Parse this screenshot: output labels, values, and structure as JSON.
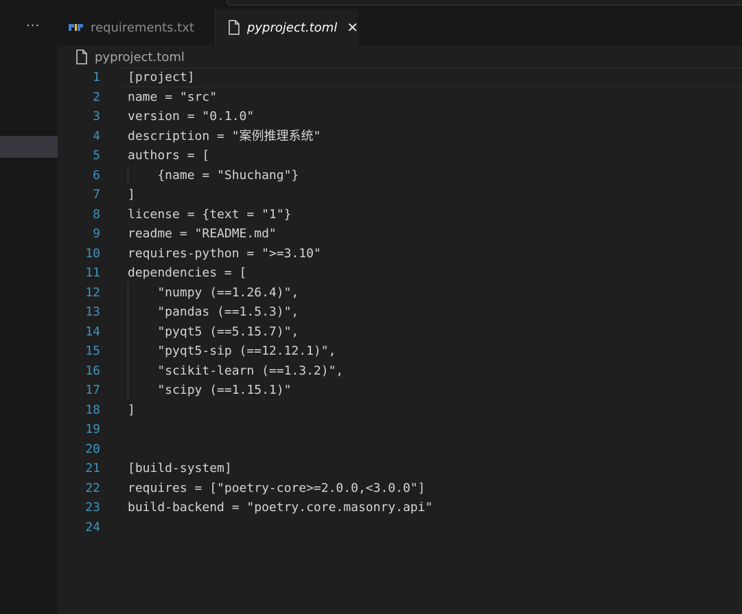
{
  "tabs": [
    {
      "label": "requirements.txt",
      "icon": "pip-icon",
      "active": false
    },
    {
      "label": "pyproject.toml",
      "icon": "file-icon",
      "active": true
    }
  ],
  "tab_close_glyph": "✕",
  "sidebar": {
    "more_glyph": "···"
  },
  "breadcrumb": {
    "file": "pyproject.toml"
  },
  "editor": {
    "lines": [
      {
        "n": "1",
        "text": "[project]"
      },
      {
        "n": "2",
        "text": "name = \"src\""
      },
      {
        "n": "3",
        "text": "version = \"0.1.0\""
      },
      {
        "n": "4",
        "text": "description = \"案例推理系统\""
      },
      {
        "n": "5",
        "text": "authors = ["
      },
      {
        "n": "6",
        "text": "    {name = \"Shuchang\"}"
      },
      {
        "n": "7",
        "text": "]"
      },
      {
        "n": "8",
        "text": "license = {text = \"1\"}"
      },
      {
        "n": "9",
        "text": "readme = \"README.md\""
      },
      {
        "n": "10",
        "text": "requires-python = \">=3.10\""
      },
      {
        "n": "11",
        "text": "dependencies = ["
      },
      {
        "n": "12",
        "text": "    \"numpy (==1.26.4)\","
      },
      {
        "n": "13",
        "text": "    \"pandas (==1.5.3)\","
      },
      {
        "n": "14",
        "text": "    \"pyqt5 (==5.15.7)\","
      },
      {
        "n": "15",
        "text": "    \"pyqt5-sip (==12.12.1)\","
      },
      {
        "n": "16",
        "text": "    \"scikit-learn (==1.3.2)\","
      },
      {
        "n": "17",
        "text": "    \"scipy (==1.15.1)\""
      },
      {
        "n": "18",
        "text": "]"
      },
      {
        "n": "19",
        "text": ""
      },
      {
        "n": "20",
        "text": ""
      },
      {
        "n": "21",
        "text": "[build-system]"
      },
      {
        "n": "22",
        "text": "requires = [\"poetry-core>=2.0.0,<3.0.0\"]"
      },
      {
        "n": "23",
        "text": "build-backend = \"poetry.core.masonry.api\""
      },
      {
        "n": "24",
        "text": ""
      }
    ]
  },
  "colors": {
    "editor_bg": "#1f1f1f",
    "line_number": "#3e94c0",
    "code_text": "#d4d4d4",
    "active_tab_text": "#ffffff",
    "inactive_tab_text": "#8b8b8b"
  }
}
